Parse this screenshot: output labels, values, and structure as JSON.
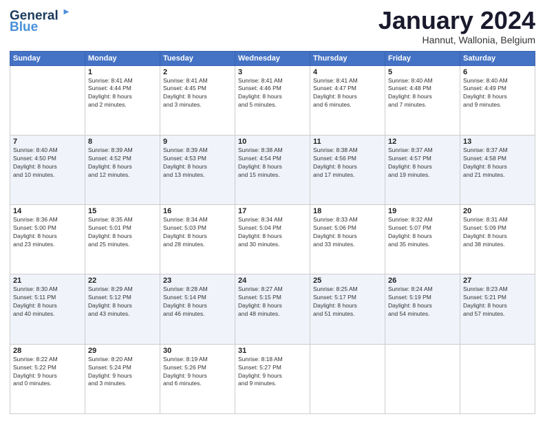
{
  "header": {
    "logo_line1": "General",
    "logo_line2": "Blue",
    "month_title": "January 2024",
    "location": "Hannut, Wallonia, Belgium"
  },
  "weekdays": [
    "Sunday",
    "Monday",
    "Tuesday",
    "Wednesday",
    "Thursday",
    "Friday",
    "Saturday"
  ],
  "weeks": [
    [
      {
        "day": "",
        "sunrise": "",
        "sunset": "",
        "daylight": ""
      },
      {
        "day": "1",
        "sunrise": "Sunrise: 8:41 AM",
        "sunset": "Sunset: 4:44 PM",
        "daylight": "Daylight: 8 hours and 2 minutes."
      },
      {
        "day": "2",
        "sunrise": "Sunrise: 8:41 AM",
        "sunset": "Sunset: 4:45 PM",
        "daylight": "Daylight: 8 hours and 3 minutes."
      },
      {
        "day": "3",
        "sunrise": "Sunrise: 8:41 AM",
        "sunset": "Sunset: 4:46 PM",
        "daylight": "Daylight: 8 hours and 5 minutes."
      },
      {
        "day": "4",
        "sunrise": "Sunrise: 8:41 AM",
        "sunset": "Sunset: 4:47 PM",
        "daylight": "Daylight: 8 hours and 6 minutes."
      },
      {
        "day": "5",
        "sunrise": "Sunrise: 8:40 AM",
        "sunset": "Sunset: 4:48 PM",
        "daylight": "Daylight: 8 hours and 7 minutes."
      },
      {
        "day": "6",
        "sunrise": "Sunrise: 8:40 AM",
        "sunset": "Sunset: 4:49 PM",
        "daylight": "Daylight: 8 hours and 9 minutes."
      }
    ],
    [
      {
        "day": "7",
        "sunrise": "Sunrise: 8:40 AM",
        "sunset": "Sunset: 4:50 PM",
        "daylight": "Daylight: 8 hours and 10 minutes."
      },
      {
        "day": "8",
        "sunrise": "Sunrise: 8:39 AM",
        "sunset": "Sunset: 4:52 PM",
        "daylight": "Daylight: 8 hours and 12 minutes."
      },
      {
        "day": "9",
        "sunrise": "Sunrise: 8:39 AM",
        "sunset": "Sunset: 4:53 PM",
        "daylight": "Daylight: 8 hours and 13 minutes."
      },
      {
        "day": "10",
        "sunrise": "Sunrise: 8:38 AM",
        "sunset": "Sunset: 4:54 PM",
        "daylight": "Daylight: 8 hours and 15 minutes."
      },
      {
        "day": "11",
        "sunrise": "Sunrise: 8:38 AM",
        "sunset": "Sunset: 4:56 PM",
        "daylight": "Daylight: 8 hours and 17 minutes."
      },
      {
        "day": "12",
        "sunrise": "Sunrise: 8:37 AM",
        "sunset": "Sunset: 4:57 PM",
        "daylight": "Daylight: 8 hours and 19 minutes."
      },
      {
        "day": "13",
        "sunrise": "Sunrise: 8:37 AM",
        "sunset": "Sunset: 4:58 PM",
        "daylight": "Daylight: 8 hours and 21 minutes."
      }
    ],
    [
      {
        "day": "14",
        "sunrise": "Sunrise: 8:36 AM",
        "sunset": "Sunset: 5:00 PM",
        "daylight": "Daylight: 8 hours and 23 minutes."
      },
      {
        "day": "15",
        "sunrise": "Sunrise: 8:35 AM",
        "sunset": "Sunset: 5:01 PM",
        "daylight": "Daylight: 8 hours and 25 minutes."
      },
      {
        "day": "16",
        "sunrise": "Sunrise: 8:34 AM",
        "sunset": "Sunset: 5:03 PM",
        "daylight": "Daylight: 8 hours and 28 minutes."
      },
      {
        "day": "17",
        "sunrise": "Sunrise: 8:34 AM",
        "sunset": "Sunset: 5:04 PM",
        "daylight": "Daylight: 8 hours and 30 minutes."
      },
      {
        "day": "18",
        "sunrise": "Sunrise: 8:33 AM",
        "sunset": "Sunset: 5:06 PM",
        "daylight": "Daylight: 8 hours and 33 minutes."
      },
      {
        "day": "19",
        "sunrise": "Sunrise: 8:32 AM",
        "sunset": "Sunset: 5:07 PM",
        "daylight": "Daylight: 8 hours and 35 minutes."
      },
      {
        "day": "20",
        "sunrise": "Sunrise: 8:31 AM",
        "sunset": "Sunset: 5:09 PM",
        "daylight": "Daylight: 8 hours and 38 minutes."
      }
    ],
    [
      {
        "day": "21",
        "sunrise": "Sunrise: 8:30 AM",
        "sunset": "Sunset: 5:11 PM",
        "daylight": "Daylight: 8 hours and 40 minutes."
      },
      {
        "day": "22",
        "sunrise": "Sunrise: 8:29 AM",
        "sunset": "Sunset: 5:12 PM",
        "daylight": "Daylight: 8 hours and 43 minutes."
      },
      {
        "day": "23",
        "sunrise": "Sunrise: 8:28 AM",
        "sunset": "Sunset: 5:14 PM",
        "daylight": "Daylight: 8 hours and 46 minutes."
      },
      {
        "day": "24",
        "sunrise": "Sunrise: 8:27 AM",
        "sunset": "Sunset: 5:15 PM",
        "daylight": "Daylight: 8 hours and 48 minutes."
      },
      {
        "day": "25",
        "sunrise": "Sunrise: 8:25 AM",
        "sunset": "Sunset: 5:17 PM",
        "daylight": "Daylight: 8 hours and 51 minutes."
      },
      {
        "day": "26",
        "sunrise": "Sunrise: 8:24 AM",
        "sunset": "Sunset: 5:19 PM",
        "daylight": "Daylight: 8 hours and 54 minutes."
      },
      {
        "day": "27",
        "sunrise": "Sunrise: 8:23 AM",
        "sunset": "Sunset: 5:21 PM",
        "daylight": "Daylight: 8 hours and 57 minutes."
      }
    ],
    [
      {
        "day": "28",
        "sunrise": "Sunrise: 8:22 AM",
        "sunset": "Sunset: 5:22 PM",
        "daylight": "Daylight: 9 hours and 0 minutes."
      },
      {
        "day": "29",
        "sunrise": "Sunrise: 8:20 AM",
        "sunset": "Sunset: 5:24 PM",
        "daylight": "Daylight: 9 hours and 3 minutes."
      },
      {
        "day": "30",
        "sunrise": "Sunrise: 8:19 AM",
        "sunset": "Sunset: 5:26 PM",
        "daylight": "Daylight: 9 hours and 6 minutes."
      },
      {
        "day": "31",
        "sunrise": "Sunrise: 8:18 AM",
        "sunset": "Sunset: 5:27 PM",
        "daylight": "Daylight: 9 hours and 9 minutes."
      },
      {
        "day": "",
        "sunrise": "",
        "sunset": "",
        "daylight": ""
      },
      {
        "day": "",
        "sunrise": "",
        "sunset": "",
        "daylight": ""
      },
      {
        "day": "",
        "sunrise": "",
        "sunset": "",
        "daylight": ""
      }
    ]
  ]
}
